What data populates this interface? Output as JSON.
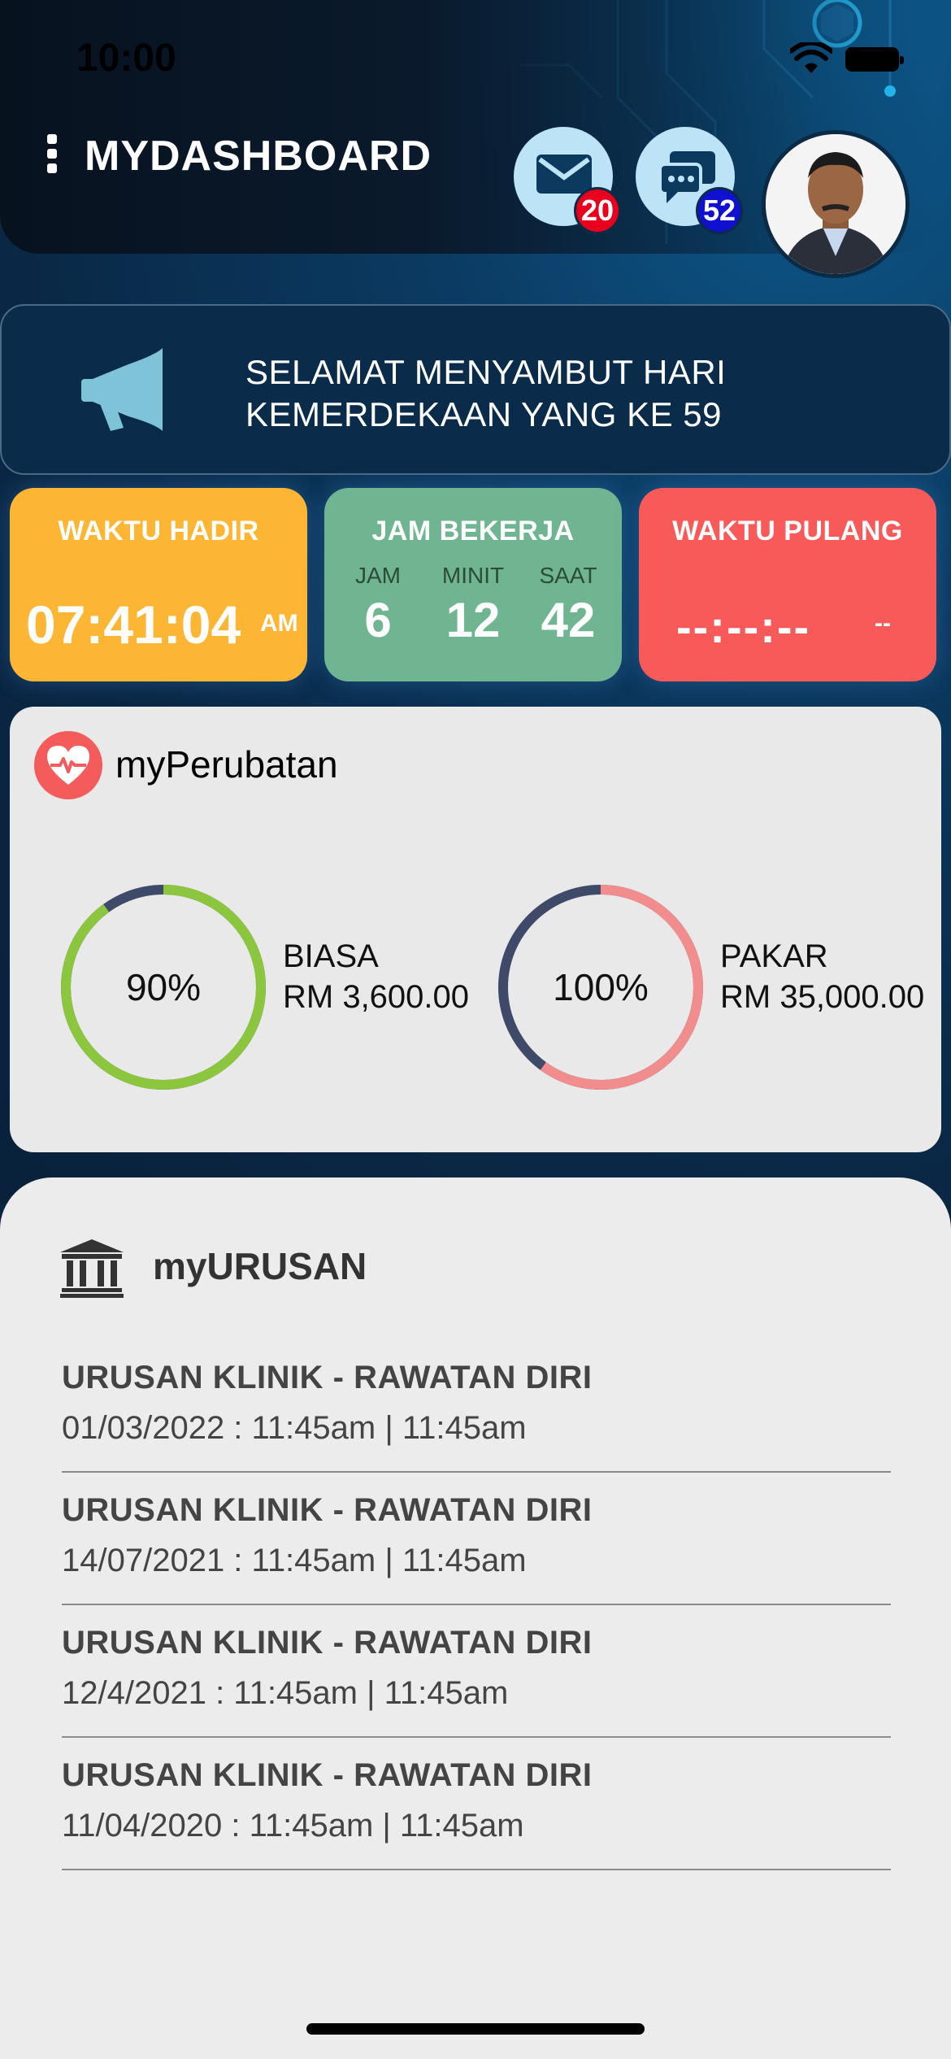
{
  "status_bar": {
    "time": "10:00"
  },
  "header": {
    "title": "MYDASHBOARD",
    "mail_badge": "20",
    "chat_badge": "52",
    "mail_badge_color": "#e8001c",
    "chat_badge_color": "#1010d0"
  },
  "announcement": {
    "text": "SELAMAT MENYAMBUT HARI\nKEMERDEKAAN YANG KE 59"
  },
  "cards": {
    "waktu_hadir": {
      "title": "WAKTU HADIR",
      "time": "07:41:04",
      "ampm": "AM",
      "color": "#fdb634"
    },
    "jam_bekerja": {
      "title": "JAM BEKERJA",
      "labels": [
        "JAM",
        "MINIT",
        "SAAT"
      ],
      "values": [
        "6",
        "12",
        "42"
      ],
      "color": "#70b591"
    },
    "waktu_pulang": {
      "title": "WAKTU PULANG",
      "time": "--:--:--",
      "ampm": "--",
      "color": "#f85a5a"
    }
  },
  "perubatan": {
    "title": "myPerubatan",
    "items": [
      {
        "percent_text": "90%",
        "percent": 0.9,
        "label": "BIASA",
        "amount": "RM 3,600.00",
        "color": "#8cc63f",
        "track": "#3e4a68"
      },
      {
        "percent_text": "100%",
        "percent": 0.6,
        "label": "PAKAR",
        "amount": "RM 35,000.00",
        "color": "#f28d8d",
        "track": "#3e4a68"
      }
    ]
  },
  "urusan": {
    "title": "myURUSAN",
    "items": [
      {
        "title": "URUSAN KLINIK - RAWATAN DIRI",
        "date": "01/03/2022 : 11:45am | 11:45am"
      },
      {
        "title": "URUSAN KLINIK - RAWATAN DIRI",
        "date": "14/07/2021 : 11:45am | 11:45am"
      },
      {
        "title": "URUSAN KLINIK - RAWATAN DIRI",
        "date": "12/4/2021 : 11:45am | 11:45am"
      },
      {
        "title": "URUSAN KLINIK - RAWATAN DIRI",
        "date": "11/04/2020 : 11:45am | 11:45am"
      }
    ]
  }
}
